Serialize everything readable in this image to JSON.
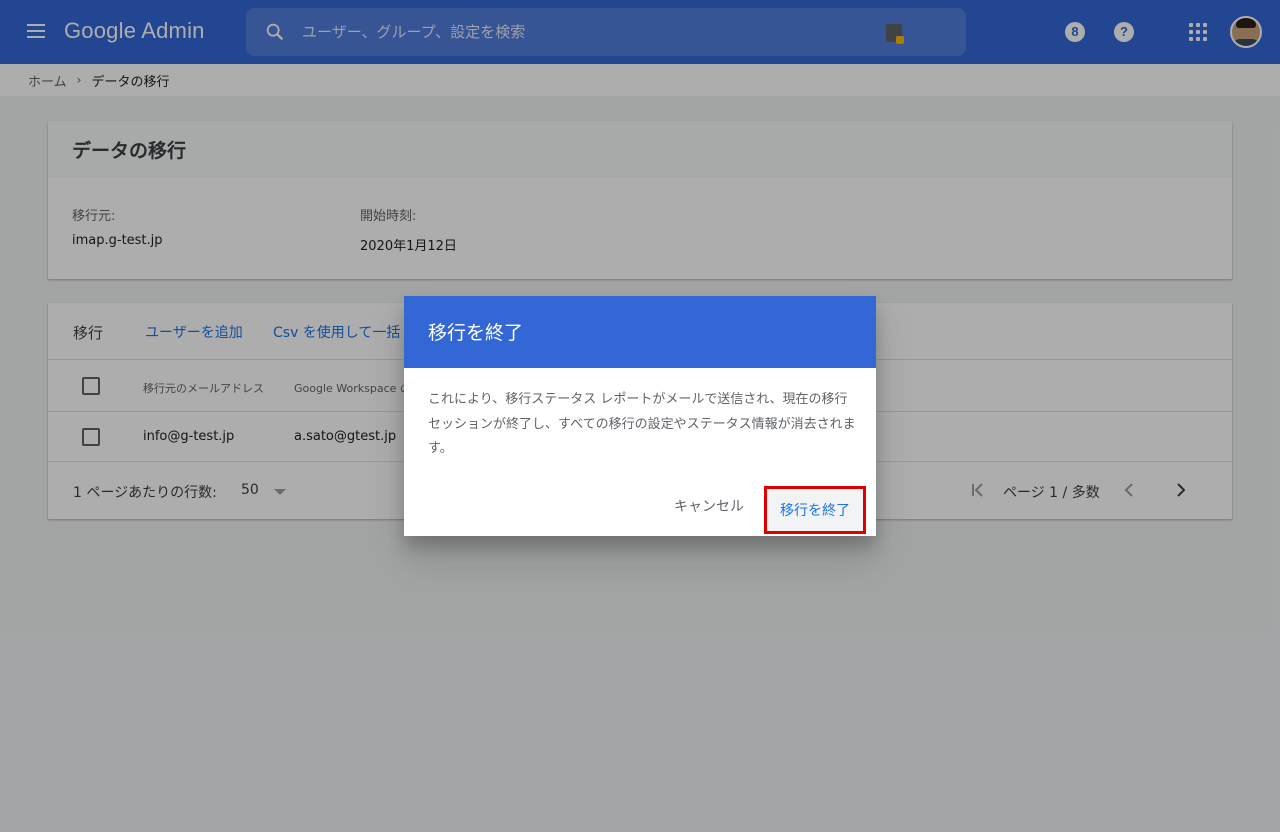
{
  "header": {
    "app_name": "Google Admin",
    "search_placeholder": "ユーザー、グループ、設定を検索",
    "support_badge": "8",
    "help_badge": "?",
    "accent_color": "#3367d6"
  },
  "breadcrumb": {
    "home": "ホーム",
    "separator": "›",
    "current": "データの移行"
  },
  "details_card": {
    "title": "データの移行",
    "source_label": "移行元:",
    "source_value": "imap.g-test.jp",
    "start_label": "開始時刻:",
    "start_value": "2020年1月12日"
  },
  "list_card": {
    "title": "移行",
    "actions": [
      "ユーザーを追加",
      "Csv を使用して一括"
    ],
    "columns": [
      "移行元のメールアドレス",
      "Google Workspace の"
    ],
    "rows": [
      {
        "source_email": "info@g-test.jp",
        "workspace_email": "a.sato@gtest.jp"
      }
    ],
    "pager": {
      "rows_per_page_label": "1 ページあたりの行数:",
      "rows_per_page_value": "50",
      "page_label": "ページ 1 / 多数"
    }
  },
  "dialog": {
    "title": "移行を終了",
    "body": "これにより、移行ステータス レポートがメールで送信され、現在の移行セッションが終了し、すべての移行の設定やステータス情報が消去されます。",
    "cancel_label": "キャンセル",
    "confirm_label": "移行を終了",
    "highlight_color": "#e00000"
  }
}
